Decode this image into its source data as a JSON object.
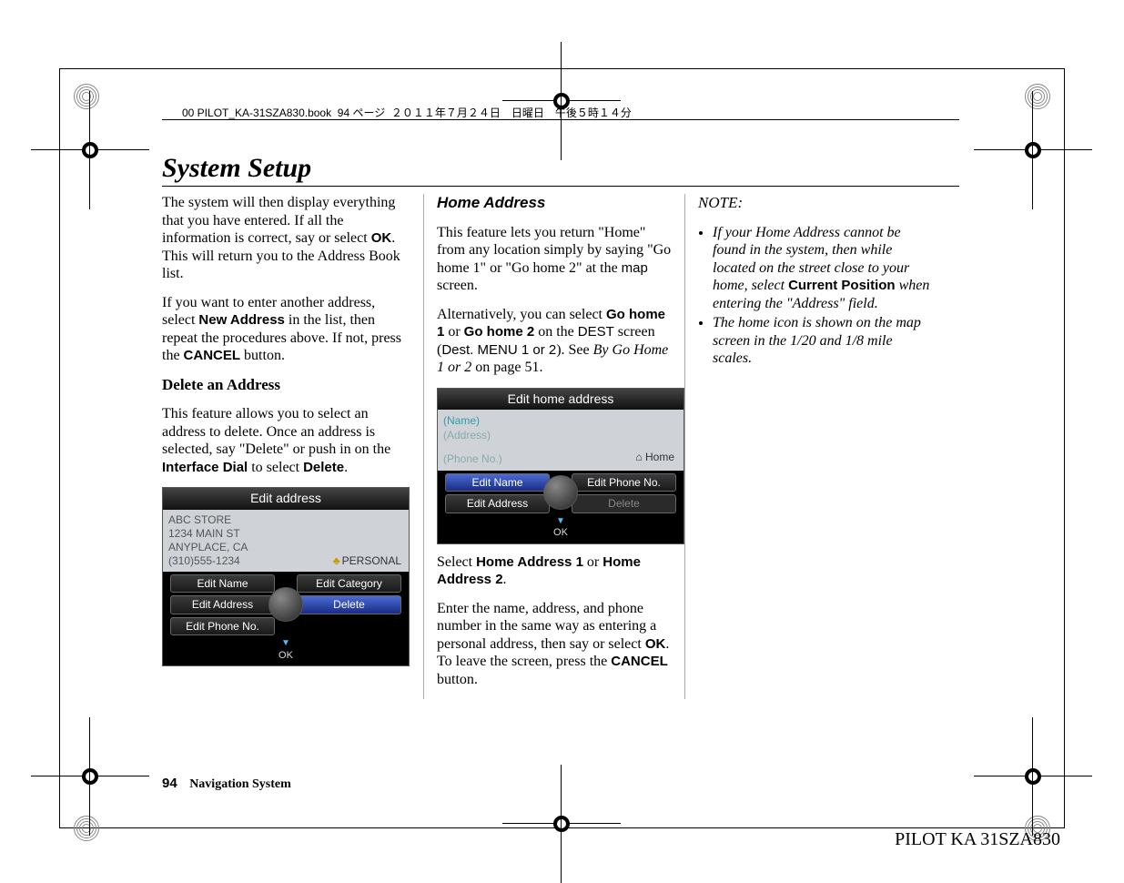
{
  "meta_line": "00 PILOT_KA-31SZA830.book  94 ページ  ２０１１年７月２４日　日曜日　午後５時１４分",
  "title": "System Setup",
  "col1": {
    "p1a": "The system will then display everything that you have entered. If all the information is correct, say or select ",
    "p1b": "OK",
    "p1c": ". This will return you to the Address Book list.",
    "p2a": "If you want to enter another address, select ",
    "p2b": "New Address",
    "p2c": " in the list, then repeat the procedures above. If not, press the ",
    "p2d": "CANCEL",
    "p2e": " button.",
    "sub": "Delete an Address",
    "p3a": "This feature allows you to select an address to delete. Once an address is selected, say \"Delete\" or push in on the ",
    "p3b": "Interface Dial",
    "p3c": " to select ",
    "p3d": "Delete",
    "p3e": "."
  },
  "screen1": {
    "title": "Edit address",
    "line1": "ABC STORE",
    "line2": "1234 MAIN ST",
    "line3": "ANYPLACE, CA",
    "line4": "(310)555-1234",
    "tag": "PERSONAL",
    "btn1": "Edit Name",
    "btn2": "Edit Category",
    "btn3": "Edit Address",
    "btn4": "Delete",
    "btn5": "Edit Phone No.",
    "ok": "OK"
  },
  "col2": {
    "h": "Home Address",
    "p1a": "This feature lets you return \"Home\" from any location simply by saying \"Go home 1\" or \"Go home 2\" at the ",
    "p1b": "map",
    "p1c": " screen.",
    "p2a": "Alternatively, you can select ",
    "p2b": "Go home 1",
    "p2c": " or ",
    "p2d": "Go home 2",
    "p2e": " on the ",
    "p2f": "DEST",
    "p2g": " screen (",
    "p2h": "Dest. MENU 1 or 2",
    "p2i": "). See ",
    "p2j": "By Go Home 1 or 2",
    "p2k": " on page 51.",
    "p3a": "Select ",
    "p3b": "Home Address 1",
    "p3c": " or ",
    "p3d": "Home Address 2",
    "p3e": ".",
    "p4a": "Enter the name, address, and phone number in the same way as entering a personal address, then say or select ",
    "p4b": "OK",
    "p4c": ". To leave the screen, press the ",
    "p4d": "CANCEL",
    "p4e": " button."
  },
  "screen2": {
    "title": "Edit home address",
    "name": "(Name)",
    "addr": "(Address)",
    "phone": "(Phone No.)",
    "home": "Home",
    "btn1": "Edit Name",
    "btn2": "Edit Phone No.",
    "btn3": "Edit Address",
    "btn4": "Delete",
    "ok": "OK"
  },
  "col3": {
    "note_h": "NOTE:",
    "li1a": "If your Home Address cannot be found in the system, then while located on the street close to your home, select ",
    "li1b": "Current Position",
    "li1c": " when entering the \"Address\" field.",
    "li2": "The home icon is shown on the map screen in the 1/20 and 1/8 mile scales."
  },
  "footer": {
    "page": "94",
    "title": "Navigation System"
  },
  "docid": "PILOT KA  31SZA830"
}
